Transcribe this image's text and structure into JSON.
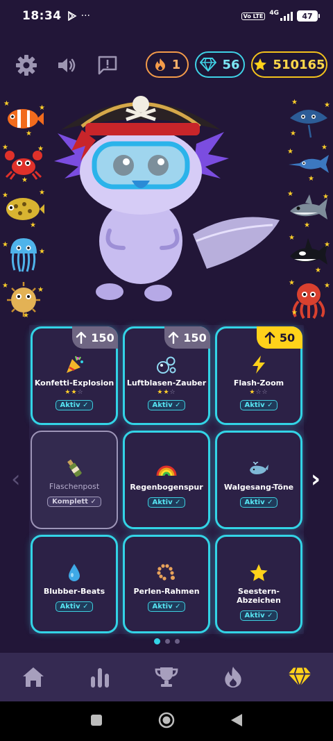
{
  "status_bar": {
    "time": "18:34",
    "dots": "···",
    "net_badge": "Vo LTE",
    "network": "4G",
    "battery": "47"
  },
  "counters": {
    "fire": "1",
    "gems": "56",
    "stars": "510165"
  },
  "cards": [
    {
      "name": "Konfetti-Explosion",
      "icon": "party-popper",
      "stars_on": "★★",
      "stars_off": "☆",
      "badge": "Aktiv ✓",
      "cost": "150",
      "cost_style": "grey"
    },
    {
      "name": "Luftblasen-Zauber",
      "icon": "bubbles",
      "stars_on": "★★",
      "stars_off": "☆",
      "badge": "Aktiv ✓",
      "cost": "150",
      "cost_style": "grey"
    },
    {
      "name": "Flash-Zoom",
      "icon": "lightning",
      "stars_on": "★",
      "stars_off": "☆☆",
      "badge": "Aktiv ✓",
      "cost": "50",
      "cost_style": "gold"
    },
    {
      "name": "Flaschenpost",
      "icon": "bottle",
      "badge": "Komplett ✓"
    },
    {
      "name": "Regenbogenspur",
      "icon": "rainbow",
      "badge": "Aktiv ✓"
    },
    {
      "name": "Walgesang-Töne",
      "icon": "whale",
      "badge": "Aktiv ✓"
    },
    {
      "name": "Blubber-Beats",
      "icon": "droplet",
      "badge": "Aktiv ✓"
    },
    {
      "name": "Perlen-Rahmen",
      "icon": "prayer-beads",
      "badge": "Aktiv ✓"
    },
    {
      "name": "Seestern-Abzeichen",
      "icon": "star",
      "badge": "Aktiv ✓"
    }
  ],
  "pager": {
    "pages": 3,
    "current": 1
  },
  "nav": {
    "arrow_left": "‹",
    "arrow_right": "›"
  },
  "bottom_tabs": [
    {
      "icon": "home-icon",
      "active": false
    },
    {
      "icon": "stats-icon",
      "active": false
    },
    {
      "icon": "trophy-icon",
      "active": false
    },
    {
      "icon": "fire-icon",
      "active": false
    },
    {
      "icon": "gem-icon",
      "active": true
    }
  ],
  "colors": {
    "background": "#221638",
    "accent_cyan": "#33d4e6",
    "gold": "#ffd21a",
    "fire": "#f39b4a",
    "active_tab": "#ffd21a",
    "inactive_tab": "#a79fbd"
  }
}
